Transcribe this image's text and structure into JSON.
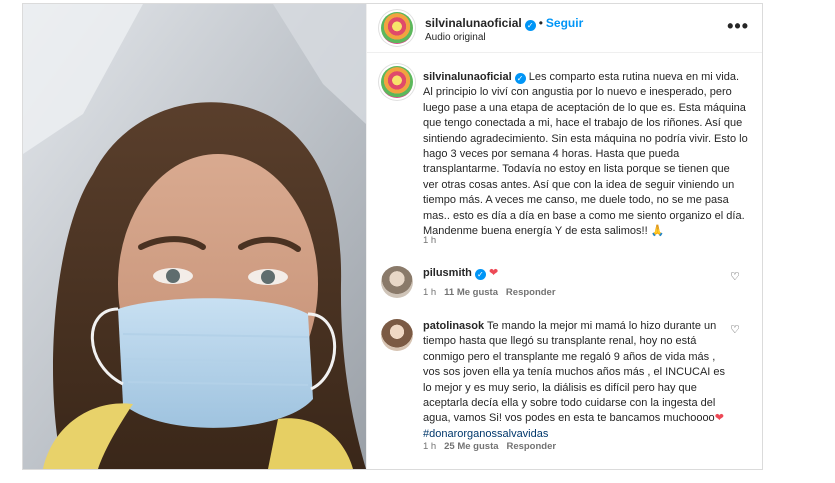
{
  "post": {
    "author": "silvinalunaoficial",
    "follow_label": "Seguir",
    "audio_label": "Audio original",
    "more_label": "•••",
    "caption": "Les comparto esta rutina nueva en mi vida. Al principio lo viví con angustia por lo nuevo e inesperado, pero luego pase a una etapa de aceptación de lo que es. Esta máquina que tengo conectada a mi, hace el trabajo de los riñones. Así que sintiendo agradecimiento. Sin esta máquina no podría vivir. Esto lo hago 3 veces por semana 4 horas. Hasta que pueda transplantarme. Todavía no estoy en lista porque se tienen que ver otras cosas antes. Así que con la idea de seguir viniendo un tiempo más. A veces me canso, me duele todo, no se me pasa mas.. esto es día a día en base a como me siento organizo el día. Mandenme buena energía Y de esta salimos!! 🙏",
    "caption_time": "1 h"
  },
  "comments": [
    {
      "author": "pilusmith",
      "text": "❤",
      "time": "1 h",
      "likes": "11 Me gusta",
      "reply": "Responder"
    },
    {
      "author": "patolinasok",
      "text": "Te mando la mejor mi mamá lo hizo durante un tiempo hasta que llegó su transplante renal, hoy no está conmigo pero el transplante me regaló 9 años de vida más , vos sos joven ella ya tenía muchos años más , el INCUCAI es lo mejor y es muy serio, la diálisis es difícil pero hay que aceptarla decía ella y sobre todo cuidarse con la ingesta del agua, vamos Si! vos podes en esta te bancamos muchoooo",
      "emoji": "❤",
      "hashtag": "#donarorganossalvavidas",
      "time": "1 h",
      "likes": "25 Me gusta",
      "reply": "Responder"
    }
  ],
  "icons": {
    "verified": "verified-badge-icon",
    "like": "heart-outline-icon"
  },
  "colors": {
    "accent": "#0095f6",
    "heart": "#ed4956",
    "hashtag": "#00376b"
  }
}
